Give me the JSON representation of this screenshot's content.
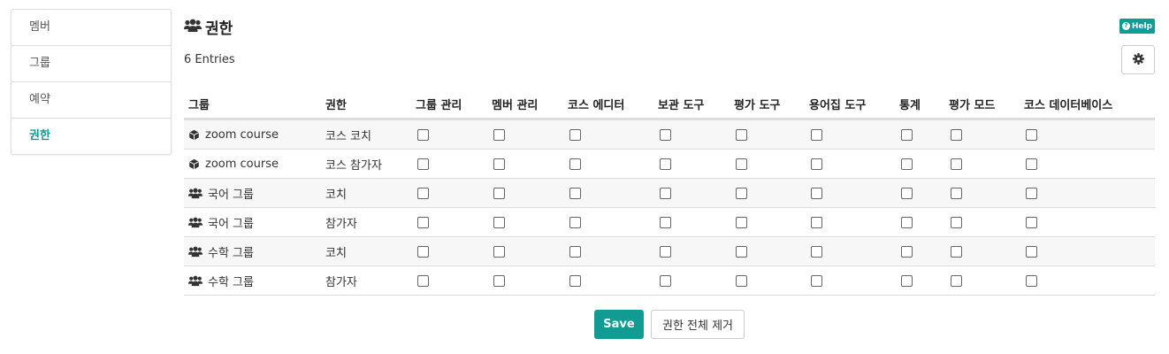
{
  "sidebar": {
    "items": [
      {
        "label": "멤버",
        "active": false
      },
      {
        "label": "그룹",
        "active": false
      },
      {
        "label": "예약",
        "active": false
      },
      {
        "label": "권한",
        "active": true
      }
    ]
  },
  "header": {
    "title": "권한",
    "title_icon": "users-icon",
    "help_label": "Help",
    "settings_icon": "gear-icon"
  },
  "entries_text": "6 Entries",
  "table": {
    "columns": [
      "그룹",
      "권한",
      "그룹 관리",
      "멤버 관리",
      "코스 에디터",
      "보관 도구",
      "평가 도구",
      "용어집 도구",
      "통계",
      "평가 모드",
      "코스 데이터베이스"
    ],
    "rows": [
      {
        "icon": "cube-icon",
        "group": "zoom course",
        "role": "코스 코치",
        "checks": [
          false,
          false,
          false,
          false,
          false,
          false,
          false,
          false,
          false
        ]
      },
      {
        "icon": "cube-icon",
        "group": "zoom course",
        "role": "코스 참가자",
        "checks": [
          false,
          false,
          false,
          false,
          false,
          false,
          false,
          false,
          false
        ]
      },
      {
        "icon": "users-icon",
        "group": "국어 그룹",
        "role": "코치",
        "checks": [
          false,
          false,
          false,
          false,
          false,
          false,
          false,
          false,
          false
        ]
      },
      {
        "icon": "users-icon",
        "group": "국어 그룹",
        "role": "참가자",
        "checks": [
          false,
          false,
          false,
          false,
          false,
          false,
          false,
          false,
          false
        ]
      },
      {
        "icon": "users-icon",
        "group": "수학 그룹",
        "role": "코치",
        "checks": [
          false,
          false,
          false,
          false,
          false,
          false,
          false,
          false,
          false
        ]
      },
      {
        "icon": "users-icon",
        "group": "수학 그룹",
        "role": "참가자",
        "checks": [
          false,
          false,
          false,
          false,
          false,
          false,
          false,
          false,
          false
        ]
      }
    ]
  },
  "footer": {
    "save_label": "Save",
    "remove_all_label": "권한 전체 제거"
  },
  "colors": {
    "accent": "#129b93"
  }
}
